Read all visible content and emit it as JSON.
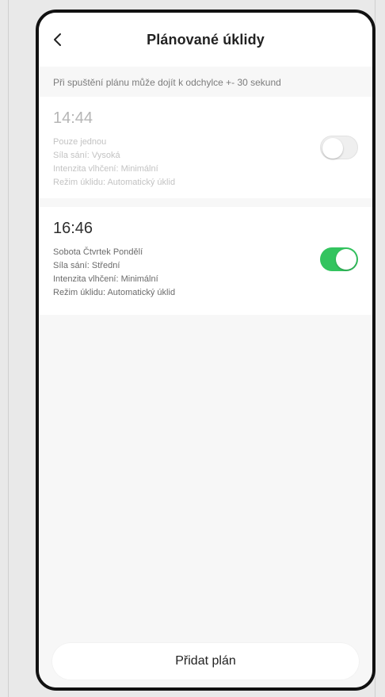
{
  "header": {
    "back_icon": "chevron-left-icon",
    "title": "Plánované úklidy"
  },
  "notice": "Při spuštění plánu může dojít k odchylce +- 30 sekund",
  "schedules": [
    {
      "time": "14:44",
      "repeat": "Pouze jednou",
      "suction": "Síla sání: Vysoká",
      "mopping": "Intenzita vlhčení: Minimální",
      "mode": "Režim úklidu: Automatický úklid",
      "enabled": false
    },
    {
      "time": "16:46",
      "repeat": "Sobota Čtvrtek Pondělí",
      "suction": "Síla sání: Střední",
      "mopping": "Intenzita vlhčení: Minimální",
      "mode": "Režim úklidu: Automatický úklid",
      "enabled": true
    }
  ],
  "footer": {
    "add_button_label": "Přidat plán"
  },
  "colors": {
    "toggle_on": "#33c45f",
    "toggle_off": "#efefef",
    "background": "#f7f7f7"
  }
}
